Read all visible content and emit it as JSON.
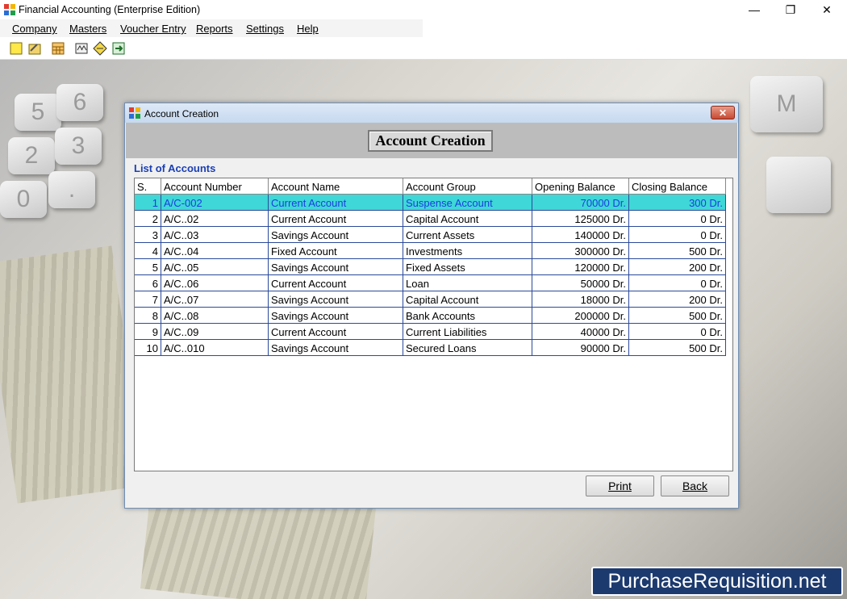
{
  "window": {
    "title": "Financial Accounting (Enterprise Edition)"
  },
  "menu": [
    "Company",
    "Masters",
    "Voucher Entry",
    "Reports",
    "Settings",
    "Help"
  ],
  "toolbar_icons": [
    "new-file-icon",
    "open-folder-icon",
    "calendar-icon",
    "balance-scale-icon",
    "tag-icon",
    "export-icon"
  ],
  "dialog": {
    "title": "Account Creation",
    "header": "Account Creation",
    "list_caption": "List of Accounts",
    "columns": [
      "S.",
      "Account Number",
      "Account Name",
      "Account Group",
      "Opening Balance",
      "Closing Balance"
    ],
    "rows": [
      [
        "1",
        "A/C-002",
        "Current Account",
        "Suspense Account",
        "70000 Dr.",
        "300 Dr."
      ],
      [
        "2",
        "A/C..02",
        "Current Account",
        "Capital Account",
        "125000 Dr.",
        "0 Dr."
      ],
      [
        "3",
        "A/C..03",
        "Savings Account",
        "Current Assets",
        "140000 Dr.",
        "0 Dr."
      ],
      [
        "4",
        "A/C..04",
        "Fixed Account",
        "Investments",
        "300000 Dr.",
        "500 Dr."
      ],
      [
        "5",
        "A/C..05",
        "Savings Account",
        "Fixed Assets",
        "120000 Dr.",
        "200 Dr."
      ],
      [
        "6",
        "A/C..06",
        "Current Account",
        "Loan",
        "50000 Dr.",
        "0 Dr."
      ],
      [
        "7",
        "A/C..07",
        "Savings Account",
        "Capital Account",
        "18000 Dr.",
        "200 Dr."
      ],
      [
        "8",
        "A/C..08",
        "Savings Account",
        "Bank Accounts",
        "200000 Dr.",
        "500 Dr."
      ],
      [
        "9",
        "A/C..09",
        "Current Account",
        "Current Liabilities",
        "40000 Dr.",
        "0 Dr."
      ],
      [
        "10",
        "A/C..010",
        "Savings Account",
        "Secured Loans",
        "90000 Dr.",
        "500 Dr."
      ]
    ],
    "selected_row": 0,
    "print_label": "Print",
    "back_label": "Back"
  },
  "watermark": "PurchaseRequisition.net",
  "colors": {
    "selection": "#3fd7d7",
    "selection_text": "#1a3fe0",
    "caption": "#1a3fb4",
    "watermark_bg": "#1c3a6e"
  }
}
